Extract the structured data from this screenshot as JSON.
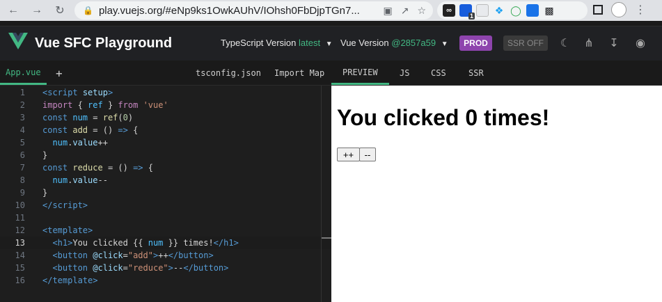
{
  "browser": {
    "url": "play.vuejs.org/#eNp9ks1OwkAUhV/IOhsh0FbDjpTGn7...",
    "icons": [
      "back-icon",
      "forward-icon",
      "reload-icon",
      "lock-icon",
      "translate-icon",
      "share-icon",
      "bookmark-star-icon"
    ],
    "extensions": [
      "infinity-icon",
      "bitwarden-icon",
      "document-icon",
      "butterfly-icon",
      "shield-icon",
      "badge-icon",
      "puzzle-icon"
    ],
    "badge_count": "1"
  },
  "header": {
    "title": "Vue SFC Playground",
    "ts_label": "TypeScript Version",
    "ts_value": "latest",
    "vue_label": "Vue Version",
    "vue_value": "@2857a59",
    "prod_label": "PROD",
    "ssr_label": "SSR OFF",
    "colors": {
      "accent": "#42b883",
      "prod": "#8e44ad"
    }
  },
  "editor_tabs": {
    "file": "App.vue",
    "add": "+",
    "tsconfig": "tsconfig.json",
    "import_map": "Import Map"
  },
  "preview_tabs": {
    "preview": "PREVIEW",
    "js": "JS",
    "css": "CSS",
    "ssr": "SSR"
  },
  "preview": {
    "heading": "You clicked 0 times!",
    "btn_add": "++",
    "btn_reduce": "--"
  },
  "code": {
    "line_numbers": [
      "1",
      "2",
      "3",
      "4",
      "5",
      "6",
      "7",
      "8",
      "9",
      "10",
      "11",
      "12",
      "13",
      "14",
      "15",
      "16"
    ]
  }
}
